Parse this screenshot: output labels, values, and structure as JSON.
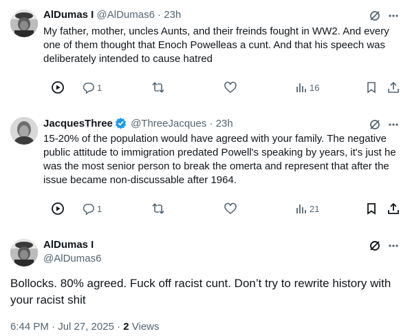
{
  "tweets": [
    {
      "name": "AlDumas I",
      "handle": "@AlDumas6",
      "time": "23h",
      "separator": "·",
      "text": "My father, mother, uncles Aunts, and their freinds fought in WW2. And every one of them thought that Enoch Powelleas a cunt. And that his speech was deliberately intended to cause hatred",
      "replies": "1",
      "views": "16"
    },
    {
      "name": "JacquesThree",
      "handle": "@ThreeJacques",
      "time": "23h",
      "separator": "·",
      "text": "15-20% of the population would have agreed with your family. The negative public attitude to immigration predated Powell's speaking by years, it's just he was the most senior person to break the omerta and represent that after the issue became non-discussable after 1964.",
      "replies": "1",
      "views": "21"
    }
  ],
  "focus": {
    "name": "AlDumas I",
    "handle": "@AlDumas6",
    "text": "Bollocks. 80% agreed. Fuck off racist cunt. Don’t  try to rewrite history with your racist shit",
    "datetime": "6:44 PM · Jul 27, 2025 · ",
    "views_count": "2",
    "views_label": " Views"
  },
  "colors": {
    "text": "#0f1419",
    "muted": "#536471",
    "verified": "#1d9bf0",
    "thread": "#cfd9de"
  },
  "icons": [
    "grok-icon",
    "more-icon",
    "play-icon",
    "reply-icon",
    "retweet-icon",
    "like-icon",
    "views-icon",
    "bookmark-icon",
    "share-icon",
    "verified-icon"
  ]
}
